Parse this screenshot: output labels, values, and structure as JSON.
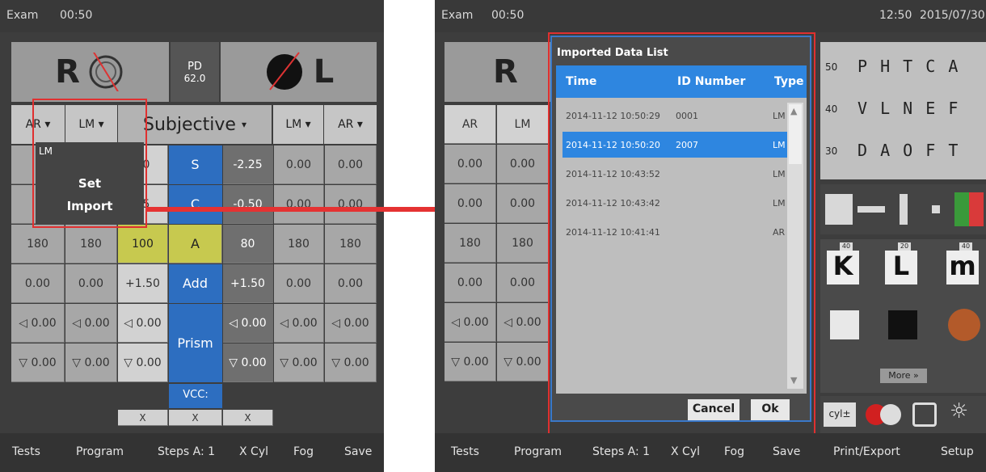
{
  "left": {
    "topbar": {
      "app": "Exam",
      "time": "00:50"
    },
    "eye_r": "R",
    "eye_l": "L",
    "pd": {
      "label": "PD",
      "value": "62.0"
    },
    "headers": [
      "AR",
      "LM",
      "Subjective",
      "LM",
      "AR"
    ],
    "rows": [
      {
        "c1": "",
        "c2": "",
        "c3": "50",
        "mid": "S",
        "c4": "-2.25",
        "c5": "0.00",
        "c6": "0.00"
      },
      {
        "c1": "",
        "c2": "",
        "c3": "75",
        "mid": "C",
        "c4": "-0.50",
        "c5": "0.00",
        "c6": "0.00"
      },
      {
        "c1": "180",
        "c2": "180",
        "c3": "100",
        "mid": "A",
        "c4": "80",
        "c5": "180",
        "c6": "180"
      },
      {
        "c1": "0.00",
        "c2": "0.00",
        "c3": "+1.50",
        "mid": "Add",
        "c4": "+1.50",
        "c5": "0.00",
        "c6": "0.00"
      },
      {
        "c1": "◁ 0.00",
        "c2": "◁ 0.00",
        "c3": "◁ 0.00",
        "mid": "Prism",
        "c4": "◁ 0.00",
        "c5": "◁ 0.00",
        "c6": "◁ 0.00"
      },
      {
        "c1": "▽ 0.00",
        "c2": "▽ 0.00",
        "c3": "▽ 0.00",
        "mid": "",
        "c4": "▽ 0.00",
        "c5": "▽ 0.00",
        "c6": "▽ 0.00"
      }
    ],
    "vcc": "VCC:",
    "x": "X",
    "popup": {
      "title": "LM",
      "set": "Set",
      "import": "Import"
    },
    "bottom": [
      "Tests",
      "Program",
      "Steps A: 1",
      "X Cyl",
      "Fog",
      "Save"
    ]
  },
  "right": {
    "topbar": {
      "app": "Exam",
      "time": "00:50",
      "clock": "12:50",
      "date": "2015/07/30"
    },
    "dialog": {
      "title": "Imported Data List",
      "columns": [
        "Time",
        "ID Number",
        "Type"
      ],
      "rows": [
        {
          "time": "2014-11-12 10:50:29",
          "id": "0001",
          "type": "LM"
        },
        {
          "time": "2014-11-12 10:50:20",
          "id": "2007",
          "type": "LM"
        },
        {
          "time": "2014-11-12 10:43:52",
          "id": "",
          "type": "LM"
        },
        {
          "time": "2014-11-12 10:43:42",
          "id": "",
          "type": "LM"
        },
        {
          "time": "2014-11-12 10:41:41",
          "id": "",
          "type": "AR"
        }
      ],
      "cancel": "Cancel",
      "ok": "Ok"
    },
    "left_cells": [
      "AR",
      "LM",
      "0.00",
      "0.00",
      "0.00",
      "0.00",
      "180",
      "180",
      "0.00",
      "0.00",
      "◁ 0.00",
      "◁ 0.00",
      "▽ 0.00",
      "▽ 0.00"
    ],
    "chart_rows": [
      {
        "size": "50",
        "letters": "P H T C A"
      },
      {
        "size": "40",
        "letters": "V L N E F"
      },
      {
        "size": "30",
        "letters": "D A O F T"
      }
    ],
    "more": "More »",
    "sizes": [
      "40",
      "20",
      "40"
    ],
    "bottom": [
      "Tests",
      "Program",
      "Steps A: 1",
      "X Cyl",
      "Fog",
      "Save",
      "Print/Export",
      "Setup"
    ]
  }
}
